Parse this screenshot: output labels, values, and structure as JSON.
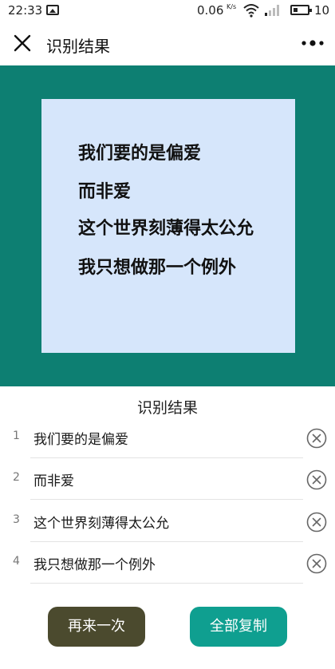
{
  "status_bar": {
    "time": "22:33",
    "net_speed": "0.06",
    "net_speed_unit": "K/s",
    "battery_level": "10"
  },
  "app_bar": {
    "title": "识别结果"
  },
  "preview": {
    "lines": [
      "我们要的是偏爱",
      "而非爱",
      "这个世界刻薄得太公允",
      "我只想做那一个例外"
    ],
    "background_color": "#0d7f72",
    "card_color": "#d6e6fb"
  },
  "results": {
    "title": "识别结果",
    "items": [
      {
        "number": "1",
        "text": "我们要的是偏爱"
      },
      {
        "number": "2",
        "text": "而非爱"
      },
      {
        "number": "3",
        "text": "这个世界刻薄得太公允"
      },
      {
        "number": "4",
        "text": "我只想做那一个例外"
      }
    ]
  },
  "actions": {
    "retry_label": "再来一次",
    "copy_all_label": "全部复制"
  },
  "colors": {
    "retry_button": "#4b4a2e",
    "copy_button": "#0f9f90"
  }
}
